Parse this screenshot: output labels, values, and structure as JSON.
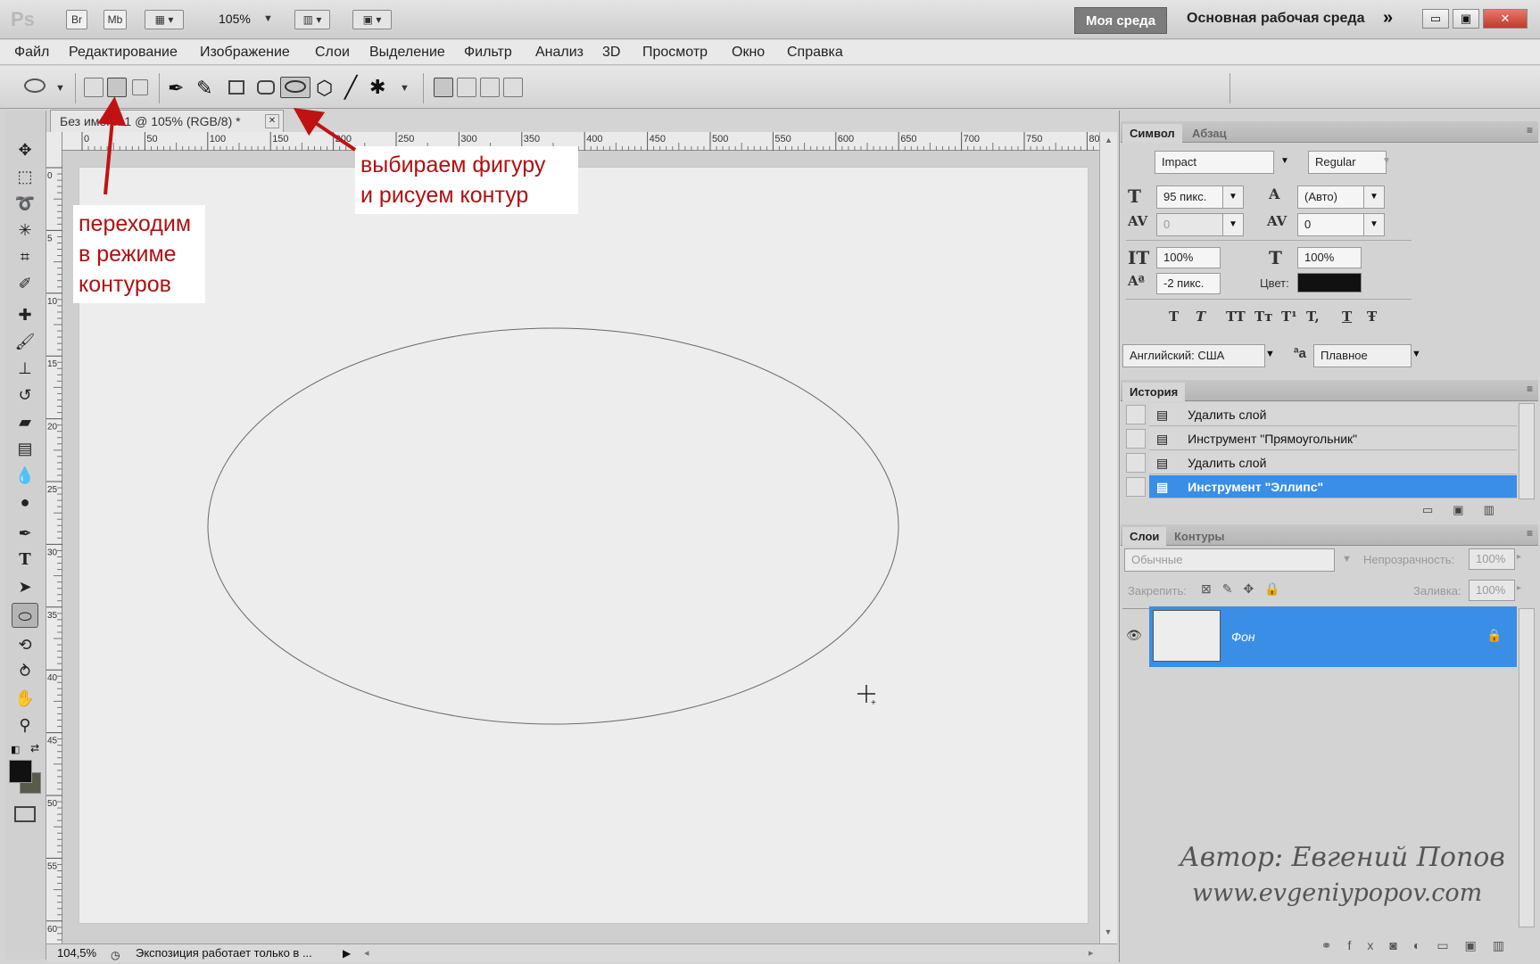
{
  "app": {
    "logo": "Ps",
    "br": "Br",
    "mb": "Mb",
    "zoom": "105%",
    "workspace_active": "Моя среда",
    "workspace_name": "Основная рабочая среда",
    "chevrons": "»",
    "min": "▭",
    "max": "▣",
    "close": "✕"
  },
  "menu": [
    "Файл",
    "Редактирование",
    "Изображение",
    "Слои",
    "Выделение",
    "Фильтр",
    "Анализ",
    "3D",
    "Просмотр",
    "Окно",
    "Справка"
  ],
  "document": {
    "tab_title": "Без имени-1 @ 105% (RGB/8) *",
    "tab_close": "✕",
    "status_zoom": "104,5%",
    "status_text": "Экспозиция работает только в ...",
    "ruler_h": [
      "0",
      "50",
      "100",
      "150",
      "200",
      "250",
      "300",
      "350",
      "400",
      "450",
      "500",
      "550",
      "600",
      "650",
      "700",
      "750",
      "80"
    ],
    "ruler_v": [
      "0",
      "5",
      "1 0",
      "1 5",
      "2 0",
      "2 5",
      "3 0",
      "3 5",
      "4 0",
      "4 5",
      "5 0",
      "5 5",
      "6 0"
    ]
  },
  "annotations": {
    "paths_mode": [
      "переходим",
      "в режиме",
      "контуров"
    ],
    "shape_tip": [
      "выбираем фигуру",
      "и рисуем контур"
    ]
  },
  "character": {
    "tab": "Символ",
    "tab2": "Абзац",
    "font": "Impact",
    "style": "Regular",
    "size": "95 пикс.",
    "leading": "(Авто)",
    "kerning": "0",
    "tracking": "0",
    "vscale": "100%",
    "hscale": "100%",
    "baseline": "-2 пикс.",
    "color_label": "Цвет:",
    "color": "#111111",
    "type_buttons": [
      "T",
      "T",
      "TT",
      "Tт",
      "T¹",
      "T,",
      "T",
      "Ŧ"
    ],
    "language": "Английский: США",
    "aa_label": "ªa",
    "aa": "Плавное"
  },
  "history": {
    "tab": "История",
    "items": [
      "Удалить слой",
      "Инструмент \"Прямоугольник\"",
      "Удалить слой",
      "Инструмент \"Эллипс\""
    ]
  },
  "layers": {
    "tab": "Слои",
    "tab2": "Контуры",
    "blend": "Обычные",
    "opacity_label": "Непрозрачность:",
    "opacity": "100%",
    "lock_label": "Закрепить:",
    "fill_label": "Заливка:",
    "fill": "100%",
    "layer_name": "Фон"
  },
  "watermark": {
    "author": "Автор: Евгений Попов",
    "site": "www.evgeniypopov.com"
  },
  "colors": {
    "accent": "#3a8ee6",
    "annotation": "#b01010",
    "foreground": "#111111",
    "background": "#5a5a4a"
  }
}
